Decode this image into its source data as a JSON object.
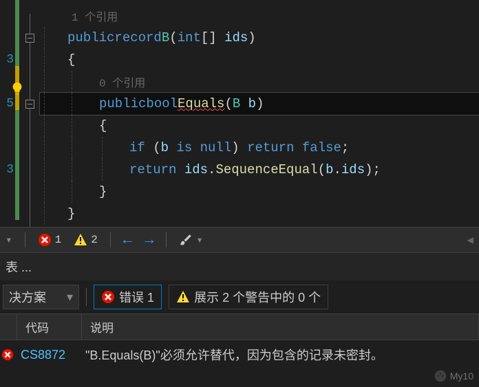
{
  "gutter": {
    "lines": [
      "",
      "",
      "3",
      "",
      "5",
      "",
      "",
      "3"
    ]
  },
  "code": {
    "ref_hint_1": "1 个引用",
    "decl_kw1": "public",
    "decl_kw2": "record",
    "decl_type": "B",
    "decl_p1": "(",
    "decl_kw3": "int",
    "decl_arr": "[]",
    "decl_param": " ids",
    "decl_p2": ")",
    "brace_open": "{",
    "ref_hint_2": "0 个引用",
    "m_kw1": "public",
    "m_kw2": "bool",
    "m_name": "Equals",
    "m_p1": "(",
    "m_ptype": "B",
    "m_pname": " b",
    "m_p2": ")",
    "inner_open": "{",
    "if_kw": "if",
    "if_p1": " (",
    "if_id": "b",
    "if_is": " is ",
    "if_null": "null",
    "if_p2": ") ",
    "if_ret": "return",
    "if_false": " false",
    "if_semi": ";",
    "r2_ret": "return",
    "r2_ids": " ids",
    "r2_dot": ".",
    "r2_fn": "SequenceEqual",
    "r2_p1": "(",
    "r2_b": "b",
    "r2_dot2": ".",
    "r2_ids2": "ids",
    "r2_p2": ")",
    "r2_semi": ";",
    "inner_close": "}",
    "brace_close": "}"
  },
  "toolbar": {
    "error_count": "1",
    "warning_count": "2"
  },
  "search_label": "表 ...",
  "filters": {
    "scope": "决方案",
    "errors_btn": "错误 1",
    "warnings_btn": "展示 2 个警告中的 0 个"
  },
  "headers": {
    "h2": "代码",
    "h3": "说明"
  },
  "error_row": {
    "code": "CS8872",
    "msg": "\"B.Equals(B)\"必须允许替代，因为包含的记录未密封。"
  },
  "watermark": "My10"
}
